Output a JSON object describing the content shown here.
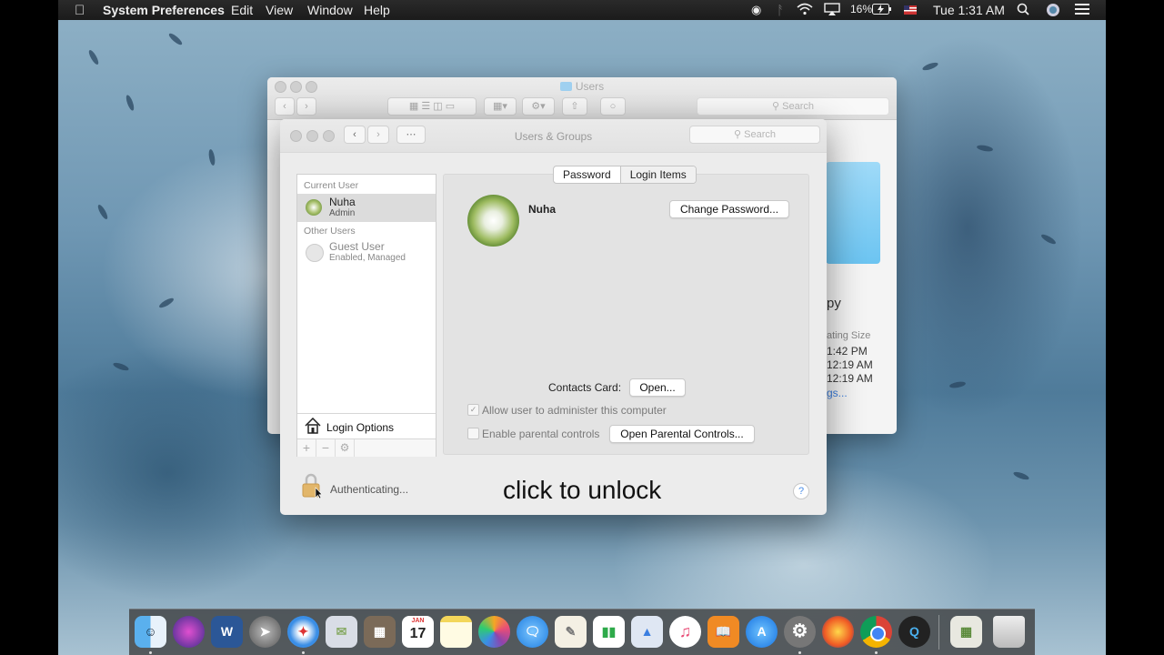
{
  "menubar": {
    "app_name": "System Preferences",
    "menus": [
      "Edit",
      "View",
      "Window",
      "Help"
    ],
    "battery": "16%",
    "clock": "Tue 1:31 AM"
  },
  "finder": {
    "title": "Users",
    "search_placeholder": "Search",
    "partial_name": "py",
    "partial_header": "ating Size",
    "partial_times": [
      "1:42 PM",
      "12:19 AM",
      "12:19 AM"
    ],
    "partial_link": "gs..."
  },
  "prefs": {
    "title": "Users & Groups",
    "search_placeholder": "Search",
    "current_user_header": "Current User",
    "other_users_header": "Other Users",
    "users": [
      {
        "name": "Nuha",
        "role": "Admin"
      },
      {
        "name": "Guest User",
        "role": "Enabled, Managed"
      }
    ],
    "login_options": "Login Options",
    "tabs": [
      "Password",
      "Login Items"
    ],
    "active_tab": "Login Items",
    "selected_user_name": "Nuha",
    "change_password": "Change Password...",
    "contacts_card_label": "Contacts Card:",
    "open_button": "Open...",
    "allow_admin_label": "Allow user to administer this computer",
    "parental_label": "Enable parental controls",
    "open_parental_button": "Open Parental Controls...",
    "lock_status": "Authenticating...",
    "help": "?"
  },
  "overlay_caption": "click to unlock",
  "dock": {
    "icons": [
      "finder-icon",
      "siri-icon",
      "word-icon",
      "launchpad-icon",
      "safari-icon",
      "mail-icon",
      "calculator-icon",
      "calendar-icon",
      "notes-icon",
      "photos-icon",
      "messages-icon",
      "textedit-icon",
      "numbers-icon",
      "keynote-icon",
      "itunes-icon",
      "ibooks-icon",
      "app-store-icon",
      "system-preferences-icon",
      "firefox-icon",
      "chrome-icon",
      "quicktime-icon",
      "preview-icon",
      "trash-icon"
    ],
    "calendar_month": "JAN",
    "calendar_day": "17",
    "word_letter": "W"
  },
  "colors": {
    "accent": "#4a8ee8",
    "selection": "#dcdcdc"
  }
}
